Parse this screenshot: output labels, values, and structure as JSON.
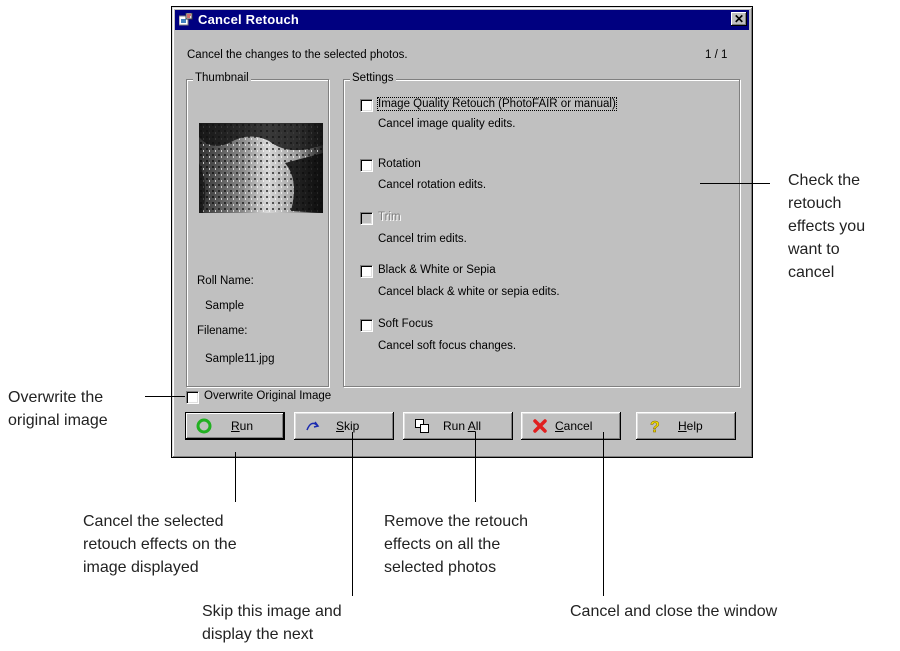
{
  "dialog": {
    "title": "Cancel Retouch",
    "description": "Cancel the changes to the selected photos.",
    "counter": "1 /  1",
    "thumbnail_group": {
      "label": "Thumbnail",
      "roll_name_label": "Roll Name:",
      "roll_name_value": "Sample",
      "filename_label": "Filename:",
      "filename_value": "Sample11.jpg"
    },
    "settings": {
      "label": "Settings",
      "options": [
        {
          "label": "Image Quality Retouch (PhotoFAIR or manual)",
          "description": "Cancel image quality edits.",
          "checked": false,
          "enabled": true
        },
        {
          "label": "Rotation",
          "description": "Cancel rotation edits.",
          "checked": false,
          "enabled": true
        },
        {
          "label": "Trim",
          "description": "Cancel trim edits.",
          "checked": false,
          "enabled": false
        },
        {
          "label": "Black & White  or  Sepia",
          "description": "Cancel black & white or sepia edits.",
          "checked": false,
          "enabled": true
        },
        {
          "label": "Soft Focus",
          "description": "Cancel soft focus changes.",
          "checked": false,
          "enabled": true
        }
      ]
    },
    "overwrite_label": "Overwrite Original Image",
    "buttons": {
      "run": {
        "pre": "",
        "key": "R",
        "post": "un"
      },
      "skip": {
        "pre": "",
        "key": "S",
        "post": "kip"
      },
      "run_all": {
        "pre": "Run ",
        "key": "A",
        "post": "ll"
      },
      "cancel": {
        "pre": "",
        "key": "C",
        "post": "ancel"
      },
      "help": {
        "pre": "",
        "key": "H",
        "post": "elp"
      }
    }
  },
  "callouts": {
    "check_effects": [
      "Check the",
      "retouch",
      "effects you",
      "want to",
      "cancel"
    ],
    "overwrite": [
      "Overwrite the",
      "original image"
    ],
    "run": [
      "Cancel the selected",
      "retouch effects on the",
      "image displayed"
    ],
    "skip": [
      "Skip this image and",
      "display the next"
    ],
    "run_all": [
      "Remove the retouch",
      "effects on all the",
      "selected photos"
    ],
    "cancel": [
      "Cancel and close the window"
    ]
  },
  "colors": {
    "titlebar": "#000080",
    "face": "#c0c0c0",
    "run_icon": "#22b022",
    "cancel_icon": "#e02020",
    "help_icon": "#f0e000"
  }
}
